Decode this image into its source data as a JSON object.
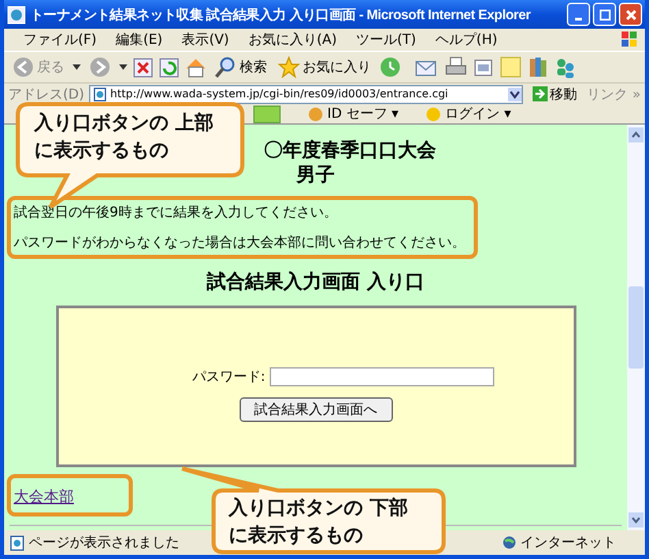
{
  "window": {
    "title": "トーナメント結果ネット収集 試合結果入力 入り口画面 - Microsoft Internet Explorer"
  },
  "menu": [
    "ファイル(F)",
    "編集(E)",
    "表示(V)",
    "お気に入り(A)",
    "ツール(T)",
    "ヘルプ(H)"
  ],
  "toolbar": {
    "back": "戻る",
    "search": "検索",
    "favorites": "お気に入り"
  },
  "address_bar": {
    "label": "アドレス(D)",
    "url": "http://www.wada-system.jp/cgi-bin/res09/id0003/entrance.cgi",
    "go": "移動",
    "links": "リンク »"
  },
  "links_bar": [
    "ID セーフ ▾",
    "ログイン ▾"
  ],
  "page": {
    "heading": [
      "〇年度春季口口大会",
      "男子"
    ],
    "notices": [
      "試合翌日の午後9時までに結果を入力してください。",
      "パスワードがわからなくなった場合は大会本部に問い合わせてください。"
    ],
    "form_title": "試合結果入力画面 入り口",
    "password_label": "パスワード:",
    "submit": "試合結果入力画面へ",
    "link": "大会本部"
  },
  "callouts": [
    {
      "lines": [
        "入り口ボタンの 上部",
        "に表示するもの"
      ]
    },
    {
      "lines": [
        "入り口ボタンの 下部",
        "に表示するもの"
      ]
    }
  ],
  "status_bar": {
    "text": "ページが表示されました",
    "zone": "インターネット"
  }
}
